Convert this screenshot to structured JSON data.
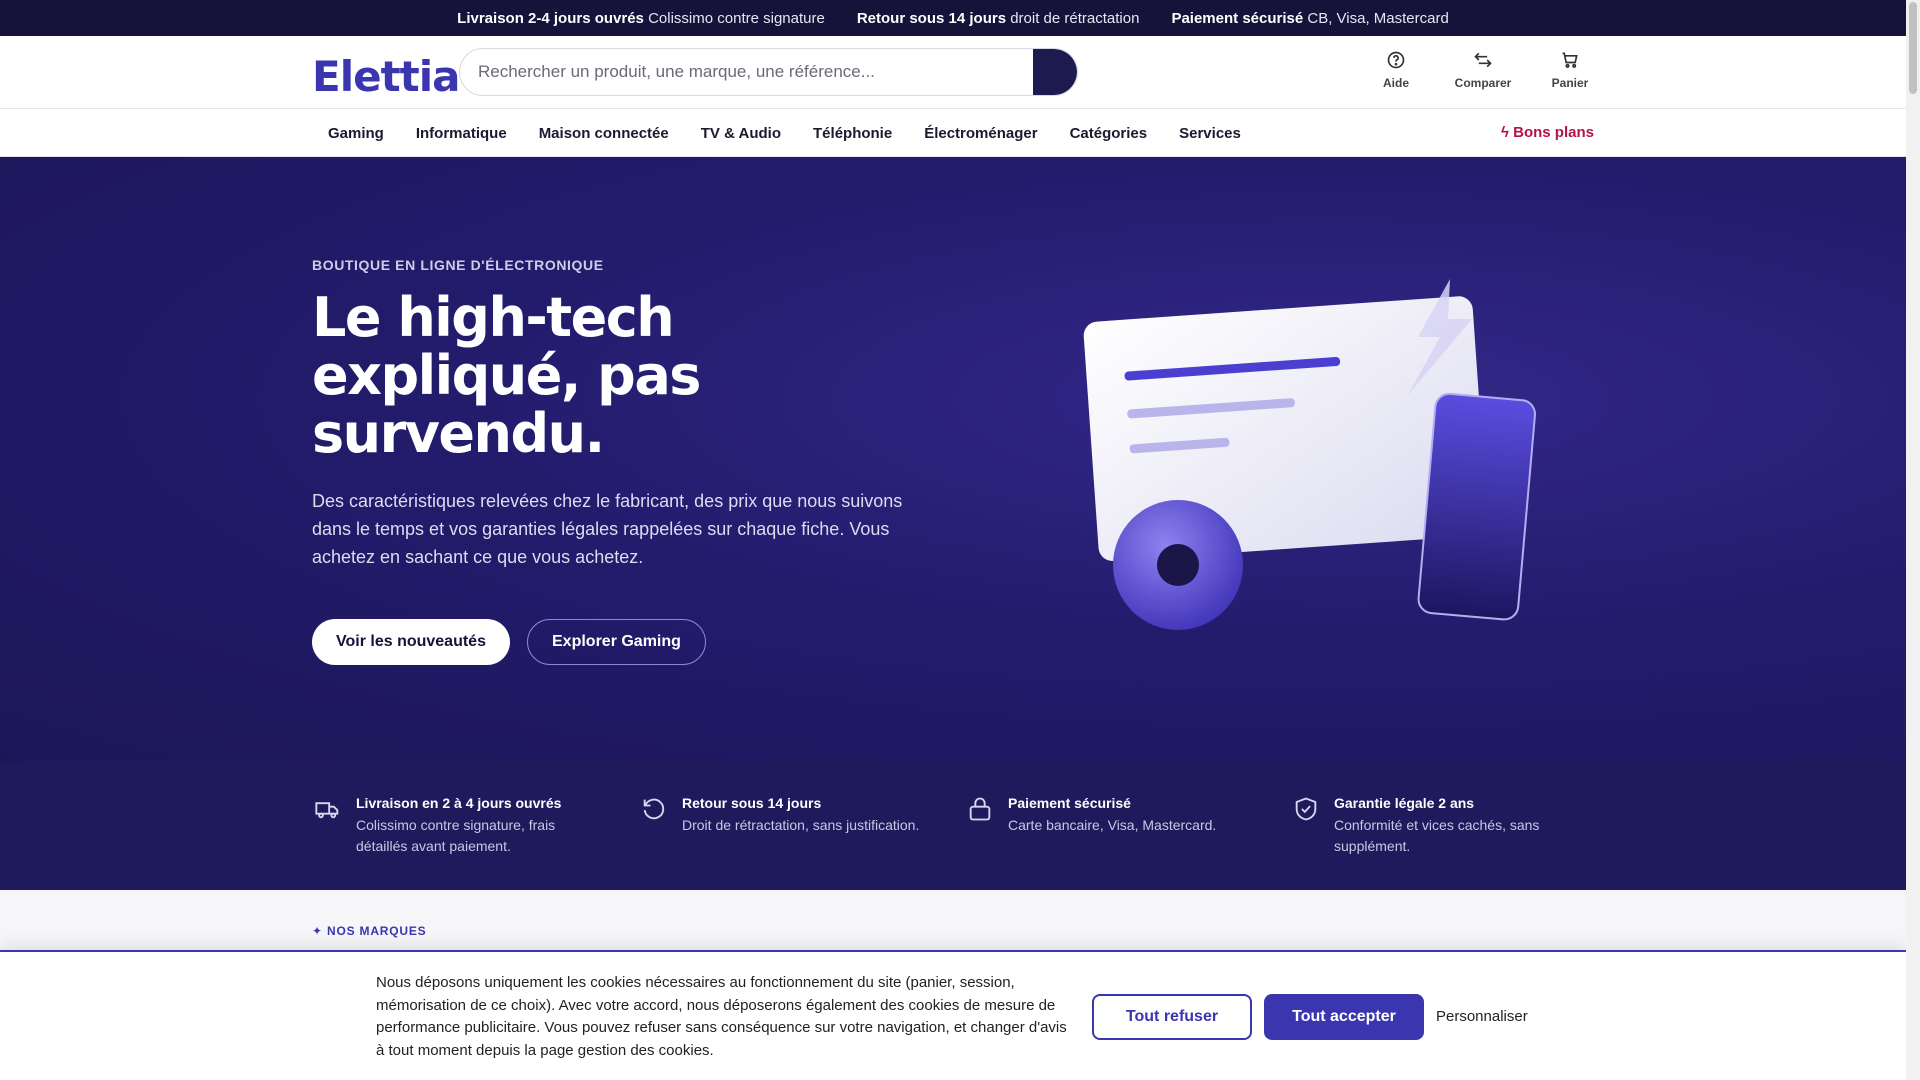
{
  "topbar": {
    "items": [
      {
        "bold": "Livraison 2-4 jours ouvrés",
        "text": "Colissimo contre signature"
      },
      {
        "bold": "Retour sous 14 jours",
        "text": "droit de rétractation"
      },
      {
        "bold": "Paiement sécurisé",
        "text": "CB, Visa, Mastercard"
      }
    ]
  },
  "header": {
    "logo": "Elettia",
    "search_placeholder": "Rechercher un produit, une marque, une référence...",
    "icons": {
      "help": "Aide",
      "compare": "Comparer",
      "cart": "Panier"
    }
  },
  "nav": {
    "items": [
      "Gaming",
      "Informatique",
      "Maison connectée",
      "TV & Audio",
      "Téléphonie",
      "Électroménager",
      "Catégories",
      "Services"
    ],
    "deals": "Bons plans"
  },
  "hero": {
    "eyebrow": "BOUTIQUE EN LIGNE D'ÉLECTRONIQUE",
    "title": "Le high-tech expliqué, pas survendu.",
    "lead": "Des caractéristiques relevées chez le fabricant, des prix que nous suivons dans le temps et vos garanties légales rappelées sur chaque fiche. Vous achetez en sachant ce que vous achetez.",
    "cta_primary": "Voir les nouveautés",
    "cta_secondary": "Explorer Gaming"
  },
  "features": [
    {
      "icon": "truck-icon",
      "title": "Livraison en 2 à 4 jours ouvrés",
      "desc": "Colissimo contre signature, frais détaillés avant paiement."
    },
    {
      "icon": "return-icon",
      "title": "Retour sous 14 jours",
      "desc": "Droit de rétractation, sans justification."
    },
    {
      "icon": "lock-icon",
      "title": "Paiement sécurisé",
      "desc": "Carte bancaire, Visa, Mastercard."
    },
    {
      "icon": "shield-check-icon",
      "title": "Garantie légale 2 ans",
      "desc": "Conformité et vices cachés, sans supplément."
    }
  ],
  "brands": {
    "label": "NOS MARQUES"
  },
  "cookie": {
    "text": "Nous déposons uniquement les cookies nécessaires au fonctionnement du site (panier, session, mémorisation de ce choix). Avec votre accord, nous déposerons également des cookies de mesure de performance publicitaire. Vous pouvez refuser sans conséquence sur votre navigation, et changer d'avis à tout moment depuis la page gestion des cookies.",
    "refuse": "Tout refuser",
    "accept": "Tout accepter",
    "customize": "Personnaliser"
  },
  "colors": {
    "accent": "#3b35b0",
    "hero_bg": "#231c6d",
    "topbar_bg": "#15133a",
    "deals": "#b3124d"
  }
}
